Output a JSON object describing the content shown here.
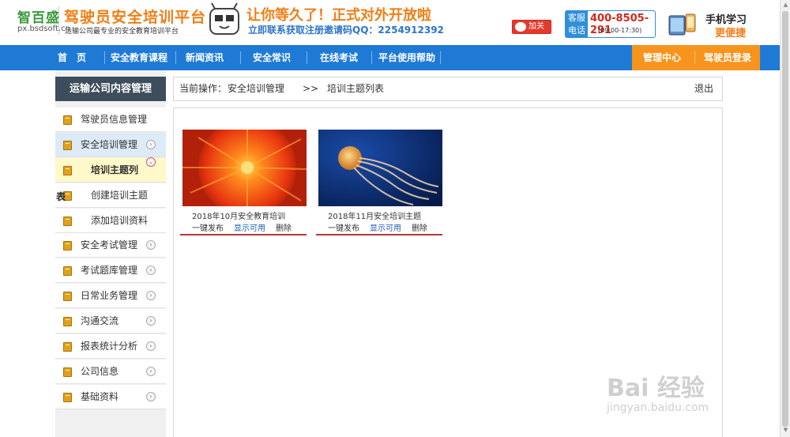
{
  "brand": {
    "logo": "智百盛",
    "domain": "px.bsdsoft.cn",
    "title": "驾驶员安全培训平台",
    "subtitle": "运输公司最专业的安全教育培训平台"
  },
  "promo": {
    "headline": "让你等久了！正式对外开放啦",
    "subline": "立即联系获取注册邀请码QQ：2254912392"
  },
  "header": {
    "weibo_label": "加关注",
    "hotline_tag": "客服电话",
    "hotline_number": "400-8505-291",
    "hotline_hours": "(09:00-17:30)",
    "mobile_line1": "手机学习",
    "mobile_line2": "更便捷"
  },
  "nav": {
    "items": [
      "首　页",
      "安全教育课程",
      "新闻资讯",
      "安全常识",
      "在线考试",
      "平台使用帮助"
    ],
    "right": [
      "管理中心",
      "驾驶员登录"
    ]
  },
  "sidebar": {
    "heading": "运输公司内容管理",
    "items": [
      {
        "label": "驾驶员信息管理"
      },
      {
        "label": "安全培训管理"
      },
      {
        "label": "培训主题列"
      },
      {
        "label": "创建培训主题"
      },
      {
        "label": "添加培训资料"
      },
      {
        "label": "安全考试管理"
      },
      {
        "label": "考试题库管理"
      },
      {
        "label": "日常业务管理"
      },
      {
        "label": "沟通交流"
      },
      {
        "label": "报表统计分析"
      },
      {
        "label": "公司信息"
      },
      {
        "label": "基础资料"
      }
    ],
    "overflow": "表"
  },
  "breadcrumb": {
    "prefix": "当前操作：",
    "section": "安全培训管理",
    "sep": ">>",
    "page": "培训主题列表",
    "logout": "退出"
  },
  "cards": [
    {
      "title": "2018年10月安全教育培训",
      "image": "red-flower",
      "publish": "一键发布",
      "show": "显示可用",
      "delete": "删除"
    },
    {
      "title": "2018年11月安全培训主题",
      "image": "jellyfish",
      "publish": "一键发布",
      "show": "显示可用",
      "delete": "删除"
    }
  ],
  "watermark": {
    "brand": "Bai 经验",
    "url": "jingyan.baidu.com"
  },
  "colors": {
    "nav_blue": "#1f7ad6",
    "nav_orange": "#f7941d",
    "brand_orange": "#f07e14",
    "sidebar_head": "#3d4d5c"
  }
}
